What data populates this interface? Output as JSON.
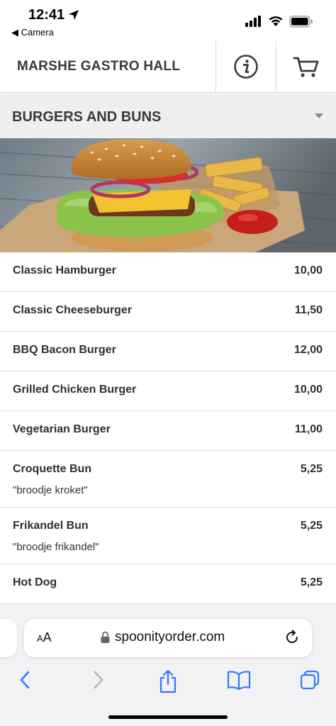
{
  "status_bar": {
    "time": "12:41",
    "back_app": "◀ Camera"
  },
  "header": {
    "title": "MARSHE GASTRO HALL",
    "info_icon": "info-icon",
    "cart_icon": "cart-icon"
  },
  "category": {
    "title": "BURGERS AND BUNS"
  },
  "menu": {
    "items": [
      {
        "name": "Classic Hamburger",
        "price": "10,00"
      },
      {
        "name": "Classic Cheeseburger",
        "price": "11,50"
      },
      {
        "name": "BBQ Bacon Burger",
        "price": "12,00"
      },
      {
        "name": "Grilled Chicken Burger",
        "price": "10,00"
      },
      {
        "name": "Vegetarian Burger",
        "price": "11,00"
      },
      {
        "name": "Croquette Bun",
        "price": "5,25",
        "description": "\"broodje kroket\""
      },
      {
        "name": "Frikandel Bun",
        "price": "5,25",
        "description": "\"broodje frikandel\""
      },
      {
        "name": "Hot Dog",
        "price": "5,25"
      }
    ]
  },
  "browser": {
    "aa_small": "A",
    "aa_large": "A",
    "url": "spoonityorder.com"
  },
  "colors": {
    "accent": "#2f7bf5",
    "header_text": "#3a3a3a",
    "category_bg": "#efefef"
  }
}
